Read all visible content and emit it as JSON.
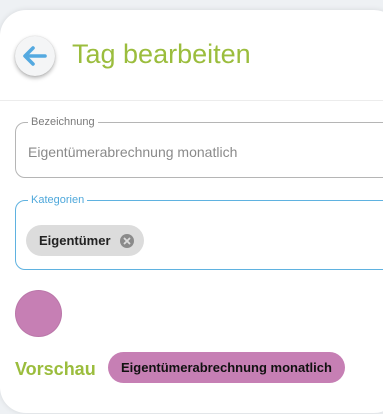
{
  "header": {
    "back_icon": "arrow-left-icon",
    "title": "Tag bearbeiten"
  },
  "form": {
    "name_field": {
      "label": "Bezeichnung",
      "value": "Eigentümerabrechnung monatlich"
    },
    "category_field": {
      "label": "Kategorien",
      "chips": [
        {
          "label": "Eigentümer",
          "remove_icon": "close-icon"
        }
      ]
    },
    "color": "#c67fb4"
  },
  "preview": {
    "label": "Vorschau",
    "tag_text": "Eigentümerabrechnung monatlich"
  },
  "colors": {
    "accent_green": "#9bbd3d",
    "focus_blue": "#5fb2e0",
    "arrow_blue": "#54a9e0",
    "tag_color": "#c67fb4"
  }
}
